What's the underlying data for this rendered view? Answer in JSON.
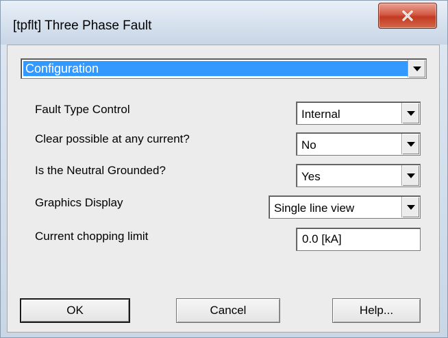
{
  "window": {
    "title": "[tpflt] Three Phase Fault"
  },
  "category": {
    "selected": "Configuration"
  },
  "params": [
    {
      "label": "Fault Type Control",
      "value": "Internal"
    },
    {
      "label": "Clear possible at any current?",
      "value": "No"
    },
    {
      "label": "Is the Neutral Grounded?",
      "value": "Yes"
    },
    {
      "label": "Graphics Display",
      "value": "Single line view"
    },
    {
      "label": "Current chopping limit",
      "value": "0.0 [kA]"
    }
  ],
  "buttons": {
    "ok": "OK",
    "cancel": "Cancel",
    "help": "Help..."
  },
  "icons": {
    "close": "close-icon",
    "dropdown": "chevron-down-icon"
  },
  "colors": {
    "selection": "#3399ff",
    "close_button": "#c23a22"
  }
}
